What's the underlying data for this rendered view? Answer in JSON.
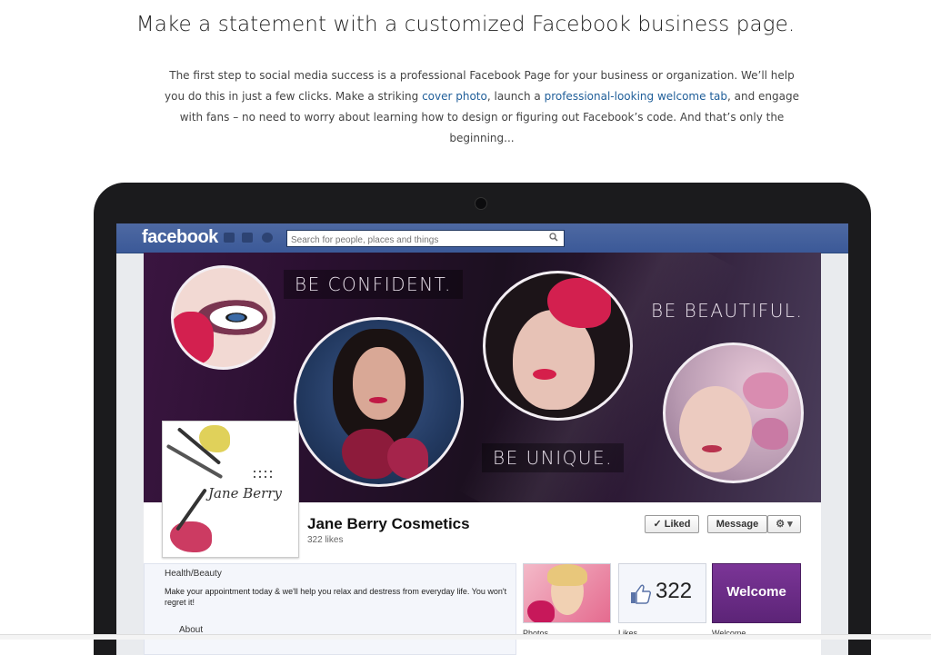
{
  "headline": "Make a statement with a customized Facebook business page.",
  "intro": {
    "part1": "The first step to social media success is a professional Facebook Page for your business or organization. We’ll help you do this in just a few clicks. Make a striking ",
    "link1": "cover photo",
    "part2": ", launch a ",
    "link2": "professional-looking welcome tab",
    "part3": ", and engage with fans – no need to worry about learning how to design or figuring out Facebook’s code. And that’s only the beginning..."
  },
  "facebook": {
    "logo": "facebook",
    "search_placeholder": "Search for people, places and things",
    "cover": {
      "text1": "BE CONFIDENT.",
      "text2": "BE BEAUTIFUL.",
      "text3": "BE UNIQUE."
    },
    "profile": {
      "logo_text": "Jane Berry",
      "name": "Jane Berry Cosmetics",
      "likes": "322 likes"
    },
    "buttons": {
      "liked": "✓ Liked",
      "message": "Message",
      "gear": "⚙ ▾"
    },
    "about": {
      "category": "Health/Beauty",
      "description": "Make your appointment today & we'll help you relax and destress from everyday life. You won't regret it!",
      "link": "About"
    },
    "tiles": {
      "likes_count": "322",
      "welcome": "Welcome",
      "label_photos": "Photos",
      "label_likes": "Likes",
      "label_welcome": "Welcome"
    }
  },
  "colors": {
    "fb_blue": "#3b5998",
    "link": "#1f5e99",
    "welcome_purple": "#6b2c87"
  }
}
